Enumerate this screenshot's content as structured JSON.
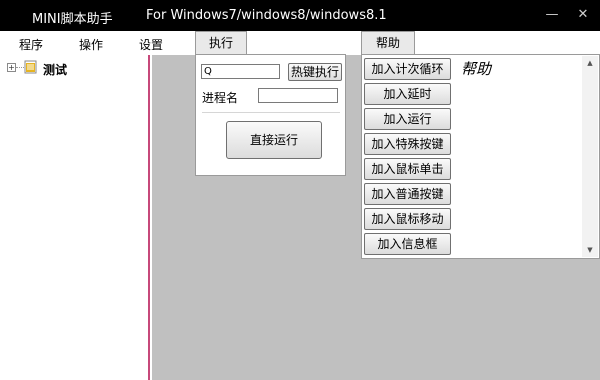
{
  "window": {
    "title": "MINI脚本助手",
    "subtitle": "For Windows7/windows8/windows8.1",
    "minimize_glyph": "—",
    "close_glyph": "✕"
  },
  "menu": {
    "items": [
      {
        "label": "程序"
      },
      {
        "label": "操作"
      },
      {
        "label": "设置"
      }
    ]
  },
  "tabs": {
    "exec": {
      "label": "执行"
    },
    "help": {
      "label": "帮助"
    }
  },
  "tree": {
    "expander": "+",
    "root_label": "测试",
    "icon": "folder-icon"
  },
  "exec_panel": {
    "hotkey_value": "Q",
    "hotkey_button": "热键执行",
    "process_label": "进程名",
    "process_value": "",
    "run_button": "直接运行"
  },
  "help_panel": {
    "help_text": "帮助",
    "commands": [
      {
        "label": "加入计次循环"
      },
      {
        "label": "加入延时"
      },
      {
        "label": "加入运行"
      },
      {
        "label": "加入特殊按键"
      },
      {
        "label": "加入鼠标单击"
      },
      {
        "label": "加入普通按键"
      },
      {
        "label": "加入鼠标移动"
      },
      {
        "label": "加入信息框"
      }
    ],
    "scroll_up": "▲",
    "scroll_down": "▼"
  },
  "colors": {
    "titlebar": "#000000",
    "workspace": "#c0c0c0",
    "tree_border": "#c7487a",
    "folder": "#e6b422"
  }
}
